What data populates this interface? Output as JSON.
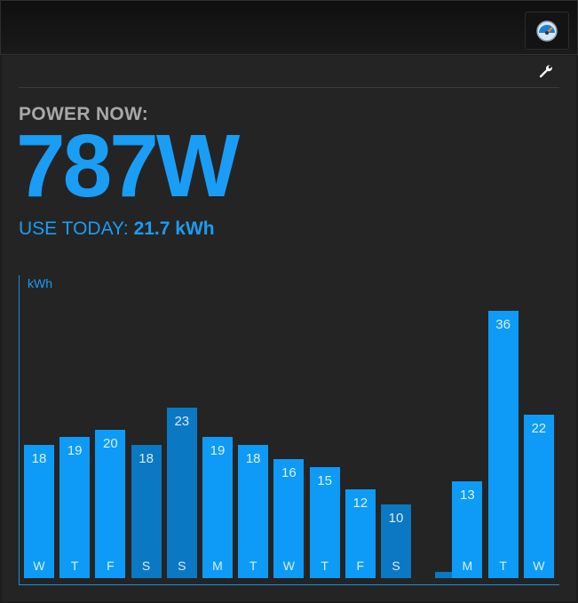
{
  "toolbar": {
    "gauge_icon": "gauge-icon"
  },
  "panel": {
    "settings_icon": "wrench-icon",
    "power_label": "POWER NOW:",
    "power_value": "787W",
    "use_today_label": "USE TODAY: ",
    "use_today_value": "21.7 kWh"
  },
  "colors": {
    "accent": "#0d9bf7",
    "accent_dim": "#0a78c2",
    "background": "#242424"
  },
  "chart_data": {
    "type": "bar",
    "ylabel": "kWh",
    "categories": [
      "W",
      "T",
      "F",
      "S",
      "S",
      "M",
      "T",
      "W",
      "T",
      "F",
      "S",
      "S",
      "M",
      "T",
      "W"
    ],
    "values": [
      18,
      19,
      20,
      18,
      23,
      19,
      18,
      16,
      15,
      12,
      10,
      1,
      13,
      36,
      22
    ],
    "labels": [
      "18",
      "19",
      "20",
      "18",
      "23",
      "19",
      "18",
      "16",
      "15",
      "12",
      "10",
      "",
      "13",
      "36",
      "22"
    ],
    "day_labels": [
      "W",
      "T",
      "F",
      "S",
      "S",
      "M",
      "T",
      "W",
      "T",
      "F",
      "S",
      "",
      "M",
      "T",
      "W"
    ],
    "highlight": [
      false,
      false,
      false,
      true,
      true,
      false,
      false,
      false,
      false,
      false,
      true,
      true,
      false,
      false,
      false
    ],
    "ylim": [
      0,
      40
    ]
  }
}
